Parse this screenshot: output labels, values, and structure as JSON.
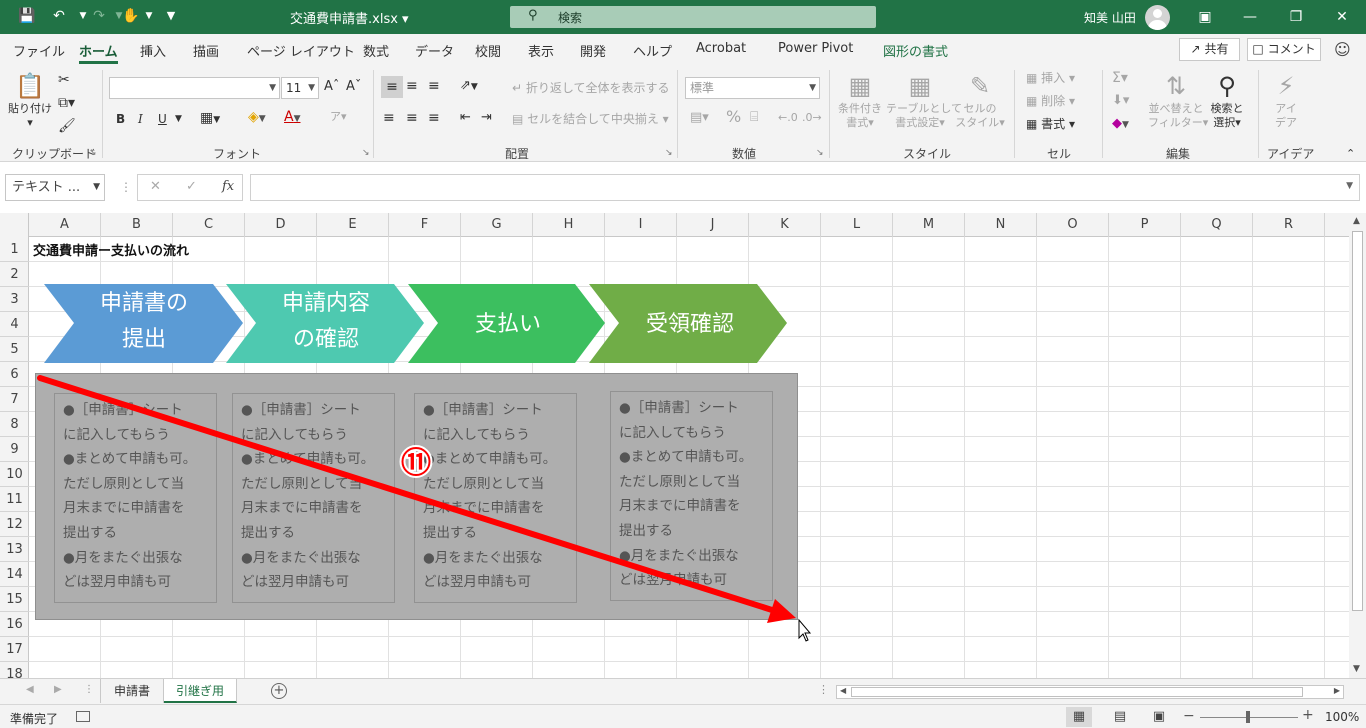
{
  "titlebar": {
    "filename": "交通費申請書.xlsx",
    "search_placeholder": "検索",
    "user_name": "知美 山田",
    "save_icon": "save-icon",
    "undo_icon": "undo-icon",
    "redo_icon": "redo-icon",
    "touch_icon": "touch-mode-icon"
  },
  "tabs": [
    {
      "label": "ファイル"
    },
    {
      "label": "ホーム",
      "active": true
    },
    {
      "label": "挿入"
    },
    {
      "label": "描画"
    },
    {
      "label": "ページ レイアウト"
    },
    {
      "label": "数式"
    },
    {
      "label": "データ"
    },
    {
      "label": "校閲"
    },
    {
      "label": "表示"
    },
    {
      "label": "開発"
    },
    {
      "label": "ヘルプ"
    },
    {
      "label": "Acrobat"
    },
    {
      "label": "Power Pivot"
    },
    {
      "label": "図形の書式"
    }
  ],
  "share": {
    "share_label": "共有",
    "comment_label": "コメント"
  },
  "ribbon": {
    "clipboard": {
      "label": "クリップボード",
      "paste": "貼り付け"
    },
    "font": {
      "label": "フォント",
      "name": "",
      "size": "11",
      "bold": "B",
      "italic": "I",
      "underline": "U"
    },
    "alignment": {
      "label": "配置",
      "wrap": "折り返して全体を表示する",
      "merge": "セルを結合して中央揃え"
    },
    "number": {
      "label": "数値",
      "format": "標準",
      "percent": "%"
    },
    "styles": {
      "label": "スタイル",
      "conditional": [
        "条件付き",
        "書式"
      ],
      "table": [
        "テーブルとして",
        "書式設定"
      ],
      "cell_styles": [
        "セルの",
        "スタイル"
      ]
    },
    "cells": {
      "label": "セル",
      "insert": "挿入",
      "delete": "削除",
      "format": "書式"
    },
    "editing": {
      "label": "編集",
      "sort": [
        "並べ替えと",
        "フィルター"
      ],
      "find": [
        "検索と",
        "選択"
      ]
    },
    "ideas": {
      "label": "アイデア",
      "btn": [
        "アイ",
        "デア"
      ]
    }
  },
  "formula_bar": {
    "name_box": "テキスト ...",
    "fx": "fx",
    "formula": ""
  },
  "columns": [
    "A",
    "B",
    "C",
    "D",
    "E",
    "F",
    "G",
    "H",
    "I",
    "J",
    "K",
    "L",
    "M",
    "N",
    "O",
    "P",
    "Q",
    "R"
  ],
  "rows": [
    "1",
    "2",
    "3",
    "4",
    "5",
    "6",
    "7",
    "8",
    "9",
    "10",
    "11",
    "12",
    "13",
    "14",
    "15",
    "16",
    "17",
    "18"
  ],
  "cell_a1": "交通費申請ー支払いの流れ",
  "arrows": [
    {
      "line1": "申請書の",
      "line2": "提出",
      "color": "#5b9bd5"
    },
    {
      "line1": "申請内容",
      "line2": "の確認",
      "color": "#4ec9b0"
    },
    {
      "line1": "支払い",
      "line2": "",
      "color": "#3cbf5f"
    },
    {
      "line1": "受領確認",
      "line2": "",
      "color": "#70ad47"
    }
  ],
  "text_boxes": [
    "●［申請書］シート\nに記入してもらう\n●まとめて申請も可。\nただし原則として当\n月末までに申請書を\n提出する\n●月をまたぐ出張な\nどは翌月申請も可",
    "●［申請書］シート\nに記入してもらう\n●まとめて申請も可。\nただし原則として当\n月末までに申請書を\n提出する\n●月をまたぐ出張な\nどは翌月申請も可",
    "●［申請書］シート\nに記入してもらう\n●まとめて申請も可。\nただし原則として当\n月末までに申請書を\n提出する\n●月をまたぐ出張な\nどは翌月申請も可",
    "●［申請書］シート\nに記入してもらう\n●まとめて申請も可。\nただし原則として当\n月末までに申請書を\n提出する\n●月をまたぐ出張な\nどは翌月申請も可"
  ],
  "annotation": {
    "step_number": "⑪",
    "arrow_color": "#ff0000"
  },
  "sheets": [
    {
      "name": "申請書",
      "active": false
    },
    {
      "name": "引継ぎ用",
      "active": true
    }
  ],
  "status": {
    "ready": "準備完了",
    "zoom": "100%"
  },
  "colors": {
    "accent": "#217346",
    "ribbon_bg": "#f3f3f3"
  }
}
